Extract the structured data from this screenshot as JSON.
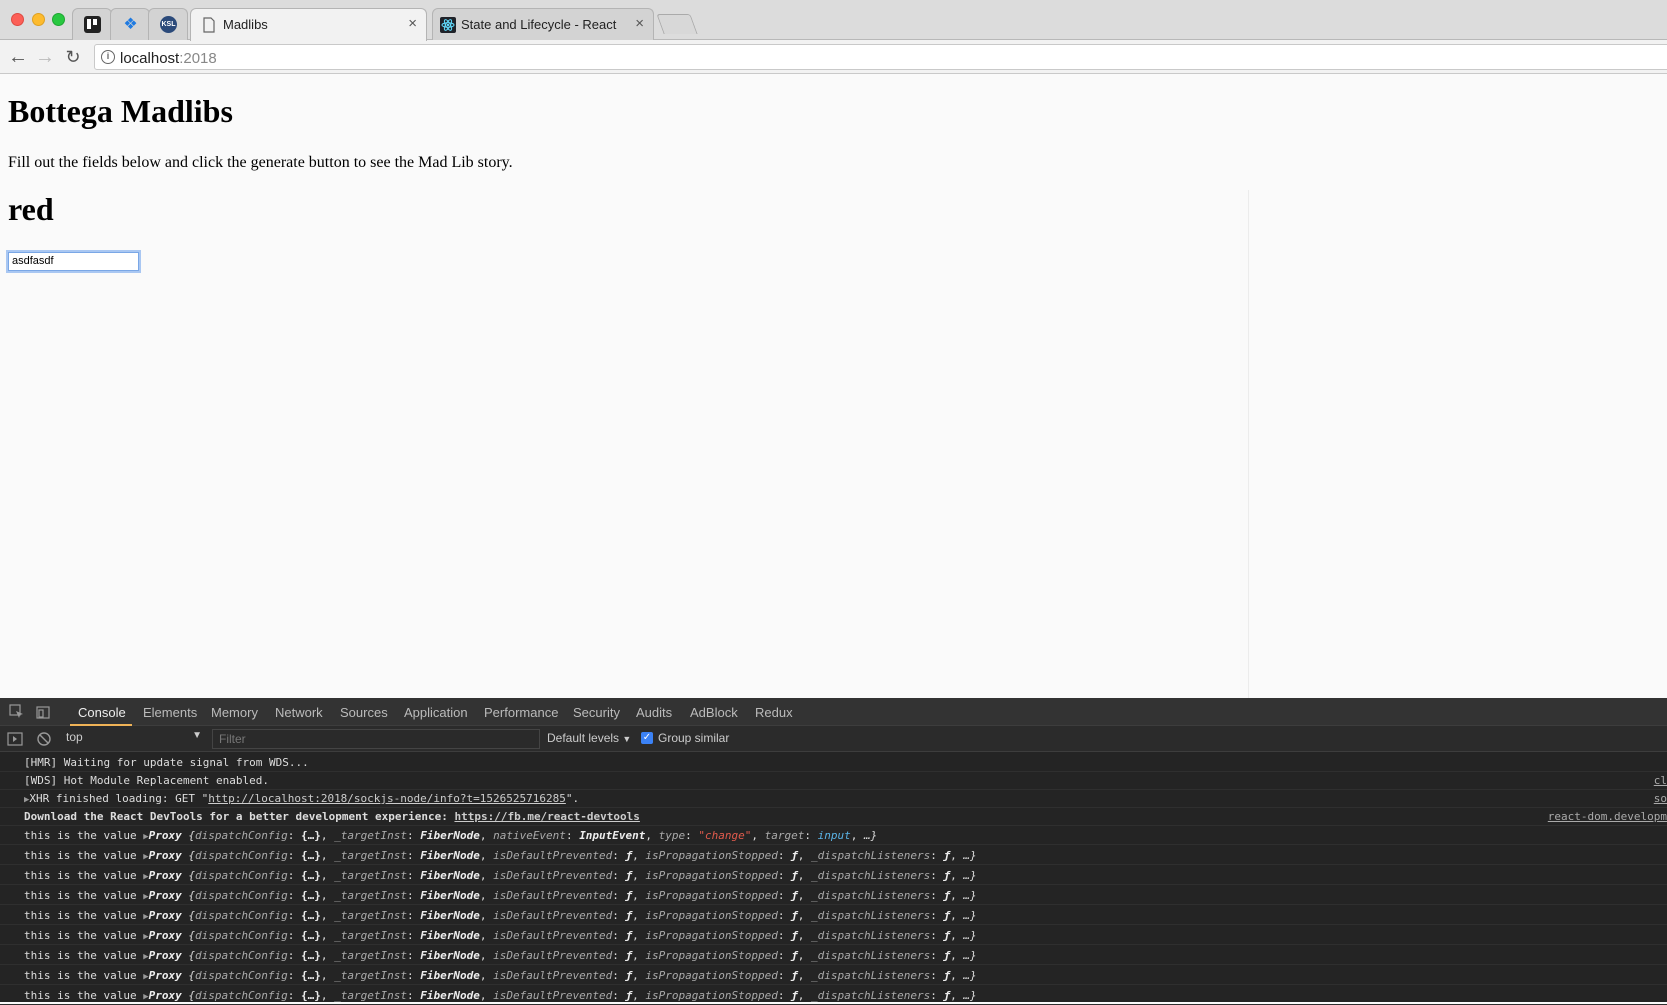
{
  "browser": {
    "tabs": [
      {
        "title": "Madlibs",
        "active": true
      },
      {
        "title": "State and Lifecycle - React",
        "active": false
      }
    ],
    "pinned_tabs": [
      "trello-icon",
      "dropbox-icon",
      "ksl-icon"
    ],
    "address": {
      "host": "localhost",
      "port": ":2018"
    }
  },
  "page": {
    "title": "Bottega Madlibs",
    "intro": "Fill out the fields below and click the generate button to see the Mad Lib story.",
    "heading_value": "red",
    "input_value": "asdfasdf"
  },
  "devtools": {
    "tabs": [
      "Console",
      "Elements",
      "Memory",
      "Network",
      "Sources",
      "Application",
      "Performance",
      "Security",
      "Audits",
      "AdBlock",
      "Redux"
    ],
    "active_tab": "Console",
    "context": "top",
    "filter_placeholder": "Filter",
    "levels": "Default levels",
    "group_similar": "Group similar",
    "log": {
      "hmr": "[HMR] Waiting for update signal from WDS...",
      "wds": "[WDS] Hot Module Replacement enabled.",
      "xhr_prefix": "XHR finished loading: GET \"",
      "xhr_url": "http://localhost:2018/sockjs-node/info?t=1526525716285",
      "xhr_suffix": "\".",
      "devtools_msg": "Download the React DevTools for a better development experience: ",
      "devtools_url": "https://fb.me/react-devtools",
      "value_label": "this is the value",
      "src_1": "cl",
      "src_2": "so",
      "src_3": "react-dom.developm"
    },
    "value_rows_count": 8
  },
  "colors": {
    "accent": "#f0b357",
    "check": "#3b82f6",
    "string": "#e25b4d"
  }
}
